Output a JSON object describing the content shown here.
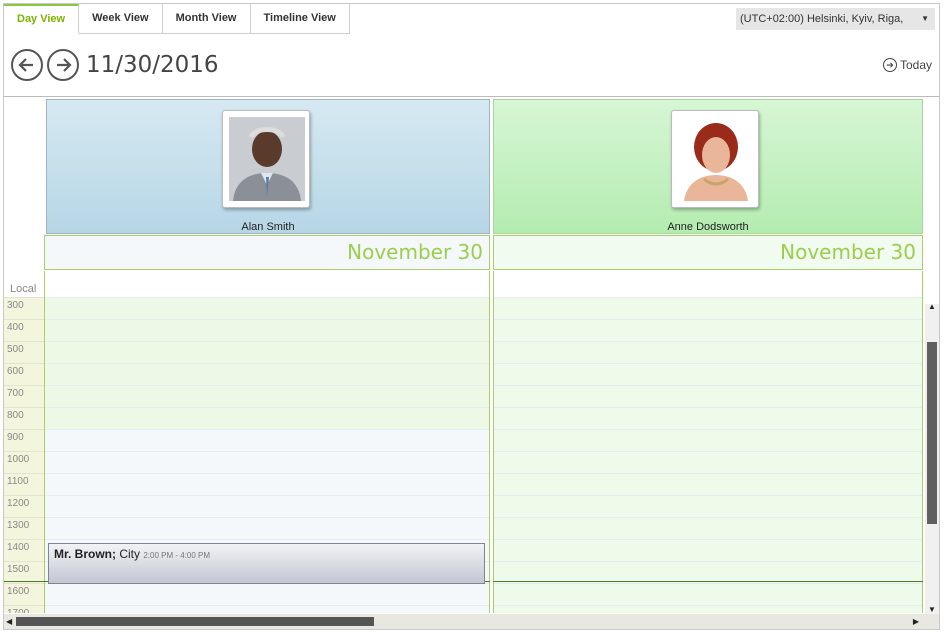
{
  "tabs": [
    {
      "label": "Day View",
      "active": true
    },
    {
      "label": "Week View",
      "active": false
    },
    {
      "label": "Month View",
      "active": false
    },
    {
      "label": "Timeline View",
      "active": false
    }
  ],
  "timezone": {
    "value": "(UTC+02:00) Helsinki, Kyiv, Riga,",
    "icon": "chevron-down-icon"
  },
  "navigation": {
    "date": "11/30/2016",
    "today_label": "Today",
    "prev_icon": "arrow-left-icon",
    "next_icon": "arrow-right-icon",
    "today_icon": "arrow-right-circle-icon"
  },
  "resources": [
    {
      "name": "Alan Smith",
      "day_label": "November 30",
      "color": "#c8e2ee"
    },
    {
      "name": "Anne Dodsworth",
      "day_label": "November 30",
      "color": "#c4f0c0"
    }
  ],
  "timeline": {
    "zone_label": "Local",
    "hours": [
      "300",
      "400",
      "500",
      "600",
      "700",
      "800",
      "900",
      "1000",
      "1100",
      "1200",
      "1300",
      "1400",
      "1500",
      "1600",
      "1700"
    ]
  },
  "appointment": {
    "title": "Mr. Brown;",
    "location": "City",
    "time": "2:00 PM - 4:00 PM"
  },
  "colors": {
    "accent": "#8cc63f",
    "appointment": "#c4c7d3"
  }
}
